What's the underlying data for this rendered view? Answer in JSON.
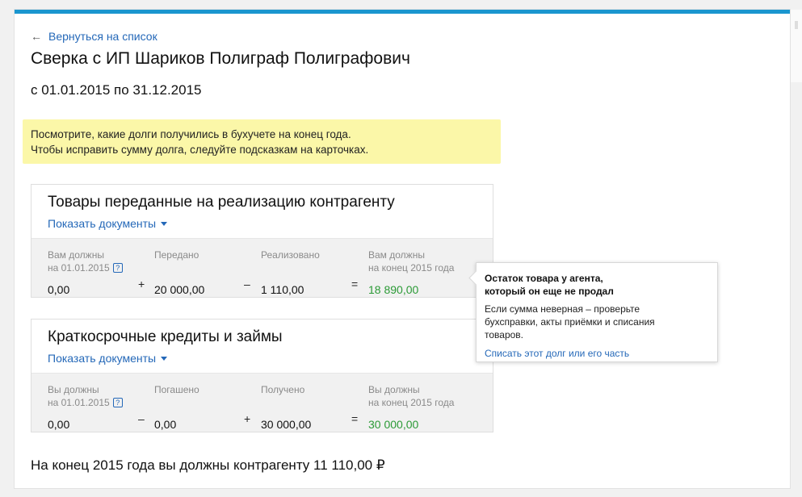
{
  "nav": {
    "back_label": "Вернуться на список",
    "back_arrow": "←"
  },
  "header": {
    "title": "Сверка с ИП Шариков Полиграф Полиграфович",
    "period": "с 01.01.2015 по 31.12.2015"
  },
  "notice": {
    "line1": "Посмотрите, какие долги получились в бухучете на конец года.",
    "line2": "Чтобы исправить сумму долга, следуйте подсказкам на карточках."
  },
  "cards": [
    {
      "title": "Товары переданные на реализацию контрагенту",
      "toggle": "Показать документы",
      "col1": {
        "label1": "Вам должны",
        "label2": "на 01.01.2015",
        "value": "0,00"
      },
      "op1": "+",
      "col2": {
        "label1": "Передано",
        "value": "20 000,00"
      },
      "op2": "–",
      "col3": {
        "label1": "Реализовано",
        "value": "1 110,00"
      },
      "op3": "=",
      "col4": {
        "label1": "Вам должны",
        "label2": "на конец 2015 года",
        "value": "18 890,00"
      }
    },
    {
      "title": "Краткосрочные кредиты и займы",
      "toggle": "Показать документы",
      "col1": {
        "label1": "Вы должны",
        "label2": "на 01.01.2015",
        "value": "0,00"
      },
      "op1": "–",
      "col2": {
        "label1": "Погашено",
        "value": "0,00"
      },
      "op2": "+",
      "col3": {
        "label1": "Получено",
        "value": "30 000,00"
      },
      "op3": "=",
      "col4": {
        "label1": "Вы должны",
        "label2": "на конец 2015 года",
        "value": "30 000,00"
      }
    }
  ],
  "help_icon": "?",
  "tooltip": {
    "title": "Остаток товара у агента, который он еще не продал",
    "body": "Если сумма неверная – проверьте бухсправки, акты приёмки и списания товаров.",
    "link": "Списать этот долг или его часть"
  },
  "total": "На конец 2015 года вы должны контрагенту 11 110,00 ₽",
  "colors": {
    "accent": "#1a96cf",
    "link": "#2468b8",
    "positive": "#2b9a36",
    "notice_bg": "#fbf7a8"
  }
}
